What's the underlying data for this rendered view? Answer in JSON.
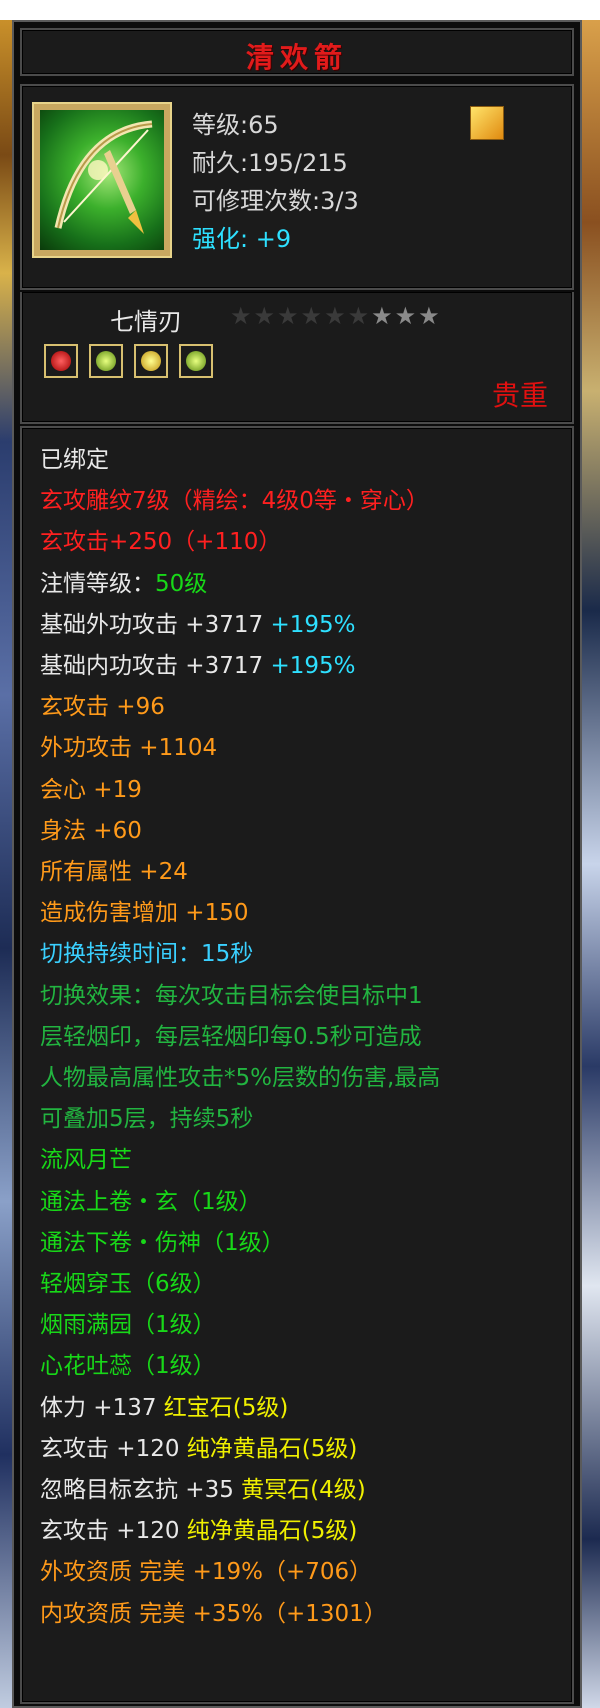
{
  "item": {
    "name": "清欢箭",
    "level_text": "等级:65",
    "durability_text": "耐久:195/215",
    "repair_text": "可修理次数:3/3",
    "enhance_label": "强化:",
    "enhance_value": "+9",
    "set_name": "七情刃",
    "stars": "★★★★★★★★★",
    "rarity": "贵重"
  },
  "colors": {
    "title": "#e11b1b",
    "rarity": "#e01010",
    "cyan": "#2ee0ff",
    "green": "#18d818",
    "orange": "#ff9a1a",
    "red": "#ff2020"
  },
  "gems": [
    "red-gem-icon",
    "green-gem-icon",
    "yellow-gem-icon",
    "green-gem-icon"
  ],
  "lines": {
    "bound": "已绑定",
    "l1": "玄攻雕纹7级（精绘：4级0等・穿心）",
    "l2": "玄攻击+250（+110）",
    "l3a": "注情等级：",
    "l3b": "50级",
    "l4a": "基础外功攻击 +3717 ",
    "l4b": "+195%",
    "l5a": "基础内功攻击 +3717 ",
    "l5b": "+195%",
    "l6": "玄攻击 +96",
    "l7": "外功攻击 +1104",
    "l8": "会心 +19",
    "l9": "身法 +60",
    "l10": "所有属性 +24",
    "l11": "造成伤害增加 +150",
    "l12": "切换持续时间：15秒",
    "l13": "切换效果：每次攻击目标会使目标中1",
    "l14": "层轻烟印，每层轻烟印每0.5秒可造成",
    "l15": "人物最高属性攻击*5%层数的伤害,最高",
    "l16": "可叠加5层，持续5秒",
    "l17": "流风月芒",
    "l18": "通法上卷・玄（1级）",
    "l19": "通法下卷・伤神（1级）",
    "l20": "轻烟穿玉（6级）",
    "l21": "烟雨满园（1级）",
    "l22": "心花吐蕊（1级）",
    "l23a": "体力 +137 ",
    "l23b": "红宝石(5级)",
    "l24a": "玄攻击 +120 ",
    "l24b": "纯净黄晶石(5级)",
    "l25a": "忽略目标玄抗 +35 ",
    "l25b": "黄冥石(4级)",
    "l26a": "玄攻击 +120 ",
    "l26b": "纯净黄晶石(5级)",
    "l27": "外攻资质  完美 +19%（+706）",
    "l28": "内攻资质  完美 +35%（+1301）"
  }
}
